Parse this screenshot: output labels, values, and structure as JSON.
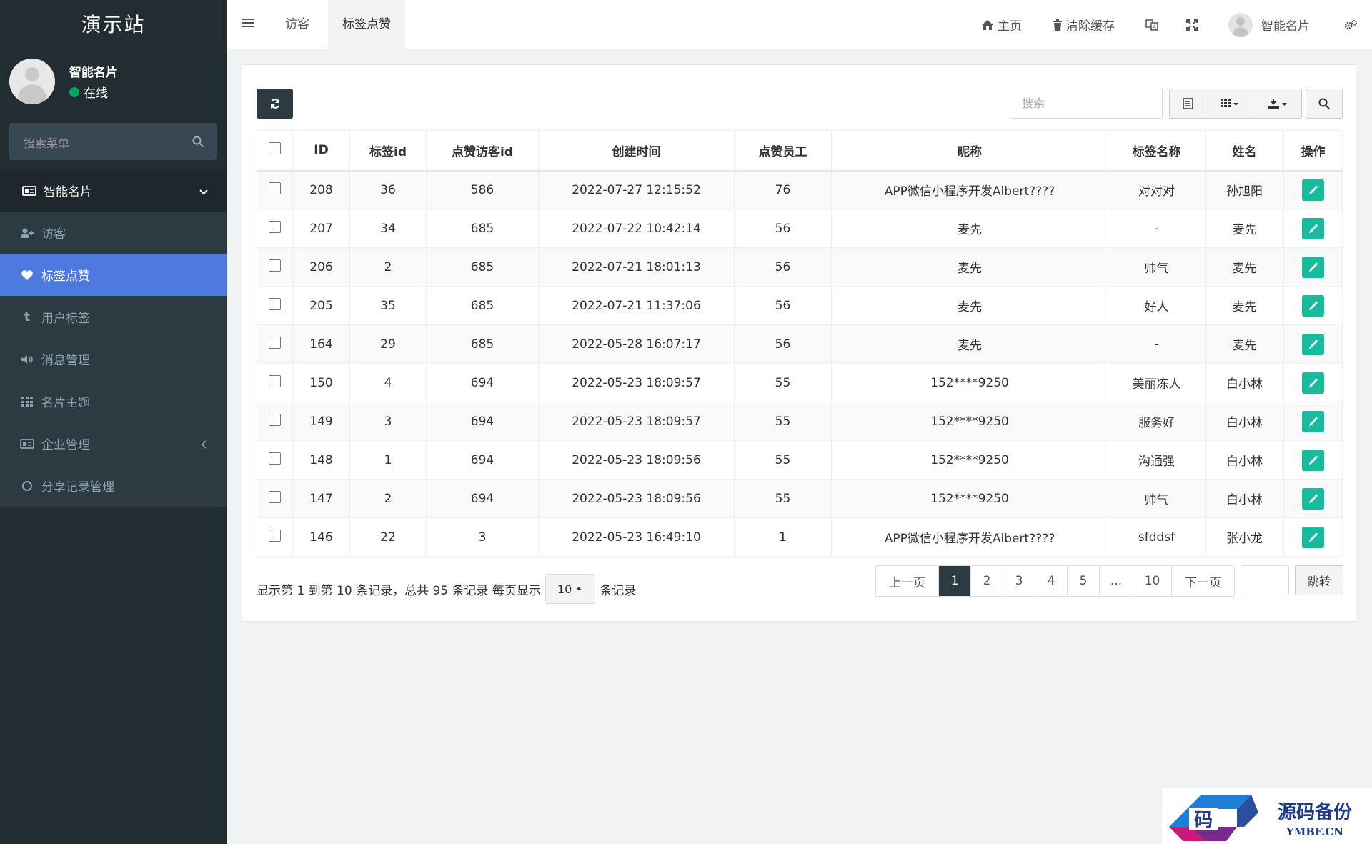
{
  "sidebar": {
    "brand": "演示站",
    "user_name": "智能名片",
    "user_status": "在线",
    "search_placeholder": "搜索菜单",
    "items": [
      {
        "label": "智能名片",
        "icon": "id-card-icon"
      },
      {
        "label": "访客",
        "icon": "user-add-icon"
      },
      {
        "label": "标签点赞",
        "icon": "heart-icon"
      },
      {
        "label": "用户标签",
        "icon": "tumblr-icon"
      },
      {
        "label": "消息管理",
        "icon": "volume-icon"
      },
      {
        "label": "名片主题",
        "icon": "grid-icon"
      },
      {
        "label": "企业管理",
        "icon": "id-card-icon"
      },
      {
        "label": "分享记录管理",
        "icon": "circle-icon"
      }
    ]
  },
  "navbar": {
    "tabs": [
      "访客",
      "标签点赞"
    ],
    "home": "主页",
    "clear_cache": "清除缓存",
    "user": "智能名片"
  },
  "toolbar": {
    "search_placeholder": "搜索"
  },
  "table": {
    "columns": [
      "ID",
      "标签id",
      "点赞访客id",
      "创建时间",
      "点赞员工",
      "昵称",
      "标签名称",
      "姓名",
      "操作"
    ],
    "rows": [
      [
        "208",
        "36",
        "586",
        "2022-07-27 12:15:52",
        "76",
        "APP微信小程序开发Albert????",
        "对对对",
        "孙旭阳"
      ],
      [
        "207",
        "34",
        "685",
        "2022-07-22 10:42:14",
        "56",
        "麦先",
        "-",
        "麦先"
      ],
      [
        "206",
        "2",
        "685",
        "2022-07-21 18:01:13",
        "56",
        "麦先",
        "帅气",
        "麦先"
      ],
      [
        "205",
        "35",
        "685",
        "2022-07-21 11:37:06",
        "56",
        "麦先",
        "好人",
        "麦先"
      ],
      [
        "164",
        "29",
        "685",
        "2022-05-28 16:07:17",
        "56",
        "麦先",
        "-",
        "麦先"
      ],
      [
        "150",
        "4",
        "694",
        "2022-05-23 18:09:57",
        "55",
        "152****9250",
        "美丽冻人",
        "白小林"
      ],
      [
        "149",
        "3",
        "694",
        "2022-05-23 18:09:57",
        "55",
        "152****9250",
        "服务好",
        "白小林"
      ],
      [
        "148",
        "1",
        "694",
        "2022-05-23 18:09:56",
        "55",
        "152****9250",
        "沟通强",
        "白小林"
      ],
      [
        "147",
        "2",
        "694",
        "2022-05-23 18:09:56",
        "55",
        "152****9250",
        "帅气",
        "白小林"
      ],
      [
        "146",
        "22",
        "3",
        "2022-05-23 16:49:10",
        "1",
        "APP微信小程序开发Albert????",
        "sfddsf",
        "张小龙"
      ]
    ]
  },
  "pagination": {
    "info": "显示第 1 到第 10 条记录，总共 95 条记录 每页显示",
    "page_size": "10",
    "suffix": "条记录",
    "prev": "上一页",
    "pages": [
      "1",
      "2",
      "3",
      "4",
      "5",
      "...",
      "10"
    ],
    "next": "下一页",
    "jump": "跳转"
  },
  "watermark": {
    "title": "源码备份",
    "site": "YMBF.CN",
    "logo_char": "码"
  },
  "colors": {
    "sidebar_bg": "#222d32",
    "active": "#4e7ae0",
    "edit": "#18bc9c",
    "online": "#00a65a"
  }
}
